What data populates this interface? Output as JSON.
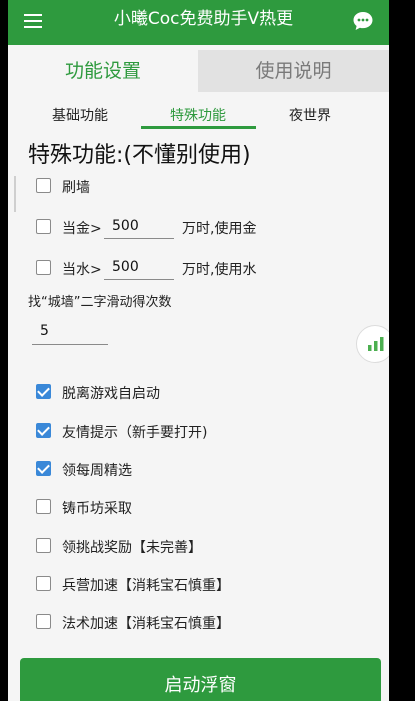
{
  "app_bar": {
    "title": "小曦Coc免费助手V热更",
    "menu_icon": "hamburger-menu-icon",
    "chat_icon": "chat-bubble-icon",
    "color": "#2e9a3e"
  },
  "main_tabs": [
    {
      "label": "功能设置",
      "active": true
    },
    {
      "label": "使用说明",
      "active": false
    }
  ],
  "sub_tabs": [
    {
      "label": "基础功能",
      "active": false
    },
    {
      "label": "特殊功能",
      "active": true
    },
    {
      "label": "夜世界",
      "active": false
    }
  ],
  "section": {
    "title": "特殊功能:(不懂别使用)"
  },
  "options": {
    "brush_wall": {
      "label": "刷墙",
      "checked": false
    },
    "gold": {
      "prefix": "当金>",
      "value": "500",
      "suffix": "万时,使用金",
      "checked": false
    },
    "elixir": {
      "prefix": "当水>",
      "value": "500",
      "suffix": "万时,使用水",
      "checked": false
    }
  },
  "swipe": {
    "label": "找“城墙”二字滑动得次数",
    "value": "5"
  },
  "toggles": [
    {
      "label": "脱离游戏自启动",
      "checked": true
    },
    {
      "label": "友情提示（新手要打开)",
      "checked": true
    },
    {
      "label": "领每周精选",
      "checked": true
    },
    {
      "label": "铸币坊采取",
      "checked": false
    },
    {
      "label": "领挑战奖励【未完善】",
      "checked": false
    },
    {
      "label": "兵营加速【消耗宝石慎重】",
      "checked": false
    },
    {
      "label": "法术加速【消耗宝石慎重】",
      "checked": false
    }
  ],
  "floating_ball_icon": "signal-bars-icon",
  "launch_button": {
    "label": "启动浮窗"
  },
  "colors": {
    "accent": "#2e9a3e",
    "checkbox_checked": "#3a88d8"
  }
}
